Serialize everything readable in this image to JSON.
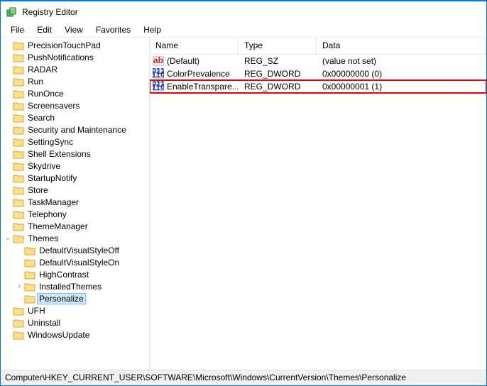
{
  "window": {
    "title": "Registry Editor"
  },
  "menu": [
    "File",
    "Edit",
    "View",
    "Favorites",
    "Help"
  ],
  "tree": [
    {
      "label": "PrecisionTouchPad",
      "indent": 0,
      "twisty": ""
    },
    {
      "label": "PushNotifications",
      "indent": 0,
      "twisty": ""
    },
    {
      "label": "RADAR",
      "indent": 0,
      "twisty": ""
    },
    {
      "label": "Run",
      "indent": 0,
      "twisty": ""
    },
    {
      "label": "RunOnce",
      "indent": 0,
      "twisty": ""
    },
    {
      "label": "Screensavers",
      "indent": 0,
      "twisty": ""
    },
    {
      "label": "Search",
      "indent": 0,
      "twisty": ""
    },
    {
      "label": "Security and Maintenance",
      "indent": 0,
      "twisty": ""
    },
    {
      "label": "SettingSync",
      "indent": 0,
      "twisty": ""
    },
    {
      "label": "Shell Extensions",
      "indent": 0,
      "twisty": ""
    },
    {
      "label": "Skydrive",
      "indent": 0,
      "twisty": ""
    },
    {
      "label": "StartupNotify",
      "indent": 0,
      "twisty": ""
    },
    {
      "label": "Store",
      "indent": 0,
      "twisty": ""
    },
    {
      "label": "TaskManager",
      "indent": 0,
      "twisty": ""
    },
    {
      "label": "Telephony",
      "indent": 0,
      "twisty": ""
    },
    {
      "label": "ThemeManager",
      "indent": 0,
      "twisty": ""
    },
    {
      "label": "Themes",
      "indent": 0,
      "twisty": "v"
    },
    {
      "label": "DefaultVisualStyleOff",
      "indent": 1,
      "twisty": ""
    },
    {
      "label": "DefaultVisualStyleOn",
      "indent": 1,
      "twisty": ""
    },
    {
      "label": "HighContrast",
      "indent": 1,
      "twisty": ""
    },
    {
      "label": "InstalledThemes",
      "indent": 1,
      "twisty": ">"
    },
    {
      "label": "Personalize",
      "indent": 1,
      "twisty": "",
      "selected": true
    },
    {
      "label": "UFH",
      "indent": 0,
      "twisty": ""
    },
    {
      "label": "Uninstall",
      "indent": 0,
      "twisty": ""
    },
    {
      "label": "WindowsUpdate",
      "indent": 0,
      "twisty": ""
    }
  ],
  "columns": {
    "name": "Name",
    "type": "Type",
    "data": "Data"
  },
  "values": [
    {
      "name": "(Default)",
      "type": "REG_SZ",
      "data": "(value not set)",
      "icon": "ab"
    },
    {
      "name": "ColorPrevalence",
      "type": "REG_DWORD",
      "data": "0x00000000 (0)",
      "icon": "bin"
    },
    {
      "name": "EnableTranspare...",
      "type": "REG_DWORD",
      "data": "0x00000001 (1)",
      "icon": "bin",
      "highlight": true
    }
  ],
  "status": "Computer\\HKEY_CURRENT_USER\\SOFTWARE\\Microsoft\\Windows\\CurrentVersion\\Themes\\Personalize"
}
